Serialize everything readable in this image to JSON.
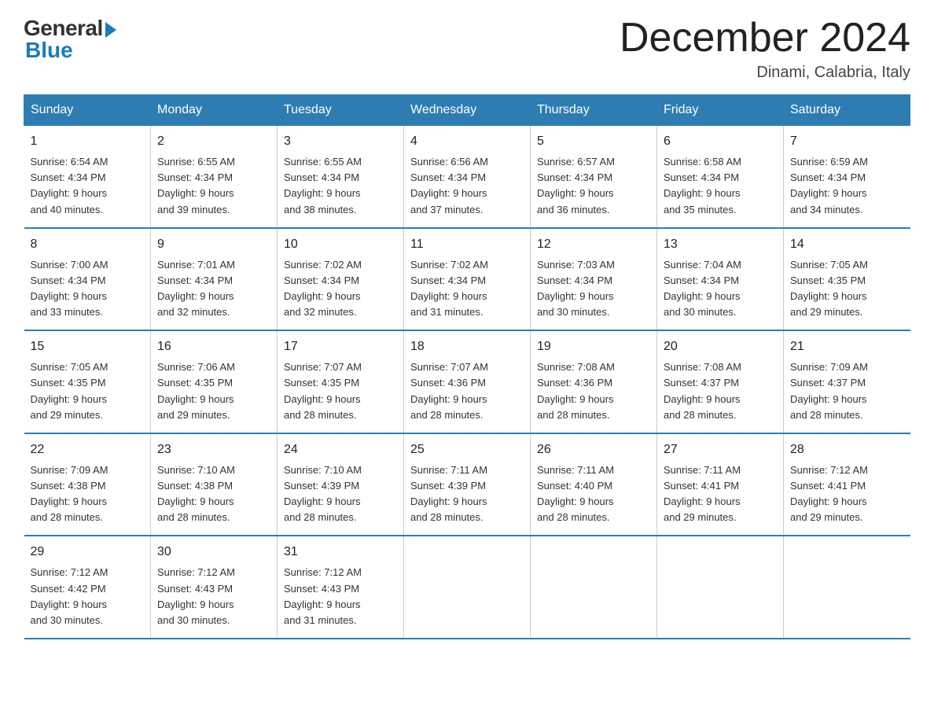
{
  "logo": {
    "general": "General",
    "blue": "Blue"
  },
  "title": "December 2024",
  "location": "Dinami, Calabria, Italy",
  "days_of_week": [
    "Sunday",
    "Monday",
    "Tuesday",
    "Wednesday",
    "Thursday",
    "Friday",
    "Saturday"
  ],
  "weeks": [
    [
      {
        "day": "1",
        "info": "Sunrise: 6:54 AM\nSunset: 4:34 PM\nDaylight: 9 hours\nand 40 minutes."
      },
      {
        "day": "2",
        "info": "Sunrise: 6:55 AM\nSunset: 4:34 PM\nDaylight: 9 hours\nand 39 minutes."
      },
      {
        "day": "3",
        "info": "Sunrise: 6:55 AM\nSunset: 4:34 PM\nDaylight: 9 hours\nand 38 minutes."
      },
      {
        "day": "4",
        "info": "Sunrise: 6:56 AM\nSunset: 4:34 PM\nDaylight: 9 hours\nand 37 minutes."
      },
      {
        "day": "5",
        "info": "Sunrise: 6:57 AM\nSunset: 4:34 PM\nDaylight: 9 hours\nand 36 minutes."
      },
      {
        "day": "6",
        "info": "Sunrise: 6:58 AM\nSunset: 4:34 PM\nDaylight: 9 hours\nand 35 minutes."
      },
      {
        "day": "7",
        "info": "Sunrise: 6:59 AM\nSunset: 4:34 PM\nDaylight: 9 hours\nand 34 minutes."
      }
    ],
    [
      {
        "day": "8",
        "info": "Sunrise: 7:00 AM\nSunset: 4:34 PM\nDaylight: 9 hours\nand 33 minutes."
      },
      {
        "day": "9",
        "info": "Sunrise: 7:01 AM\nSunset: 4:34 PM\nDaylight: 9 hours\nand 32 minutes."
      },
      {
        "day": "10",
        "info": "Sunrise: 7:02 AM\nSunset: 4:34 PM\nDaylight: 9 hours\nand 32 minutes."
      },
      {
        "day": "11",
        "info": "Sunrise: 7:02 AM\nSunset: 4:34 PM\nDaylight: 9 hours\nand 31 minutes."
      },
      {
        "day": "12",
        "info": "Sunrise: 7:03 AM\nSunset: 4:34 PM\nDaylight: 9 hours\nand 30 minutes."
      },
      {
        "day": "13",
        "info": "Sunrise: 7:04 AM\nSunset: 4:34 PM\nDaylight: 9 hours\nand 30 minutes."
      },
      {
        "day": "14",
        "info": "Sunrise: 7:05 AM\nSunset: 4:35 PM\nDaylight: 9 hours\nand 29 minutes."
      }
    ],
    [
      {
        "day": "15",
        "info": "Sunrise: 7:05 AM\nSunset: 4:35 PM\nDaylight: 9 hours\nand 29 minutes."
      },
      {
        "day": "16",
        "info": "Sunrise: 7:06 AM\nSunset: 4:35 PM\nDaylight: 9 hours\nand 29 minutes."
      },
      {
        "day": "17",
        "info": "Sunrise: 7:07 AM\nSunset: 4:35 PM\nDaylight: 9 hours\nand 28 minutes."
      },
      {
        "day": "18",
        "info": "Sunrise: 7:07 AM\nSunset: 4:36 PM\nDaylight: 9 hours\nand 28 minutes."
      },
      {
        "day": "19",
        "info": "Sunrise: 7:08 AM\nSunset: 4:36 PM\nDaylight: 9 hours\nand 28 minutes."
      },
      {
        "day": "20",
        "info": "Sunrise: 7:08 AM\nSunset: 4:37 PM\nDaylight: 9 hours\nand 28 minutes."
      },
      {
        "day": "21",
        "info": "Sunrise: 7:09 AM\nSunset: 4:37 PM\nDaylight: 9 hours\nand 28 minutes."
      }
    ],
    [
      {
        "day": "22",
        "info": "Sunrise: 7:09 AM\nSunset: 4:38 PM\nDaylight: 9 hours\nand 28 minutes."
      },
      {
        "day": "23",
        "info": "Sunrise: 7:10 AM\nSunset: 4:38 PM\nDaylight: 9 hours\nand 28 minutes."
      },
      {
        "day": "24",
        "info": "Sunrise: 7:10 AM\nSunset: 4:39 PM\nDaylight: 9 hours\nand 28 minutes."
      },
      {
        "day": "25",
        "info": "Sunrise: 7:11 AM\nSunset: 4:39 PM\nDaylight: 9 hours\nand 28 minutes."
      },
      {
        "day": "26",
        "info": "Sunrise: 7:11 AM\nSunset: 4:40 PM\nDaylight: 9 hours\nand 28 minutes."
      },
      {
        "day": "27",
        "info": "Sunrise: 7:11 AM\nSunset: 4:41 PM\nDaylight: 9 hours\nand 29 minutes."
      },
      {
        "day": "28",
        "info": "Sunrise: 7:12 AM\nSunset: 4:41 PM\nDaylight: 9 hours\nand 29 minutes."
      }
    ],
    [
      {
        "day": "29",
        "info": "Sunrise: 7:12 AM\nSunset: 4:42 PM\nDaylight: 9 hours\nand 30 minutes."
      },
      {
        "day": "30",
        "info": "Sunrise: 7:12 AM\nSunset: 4:43 PM\nDaylight: 9 hours\nand 30 minutes."
      },
      {
        "day": "31",
        "info": "Sunrise: 7:12 AM\nSunset: 4:43 PM\nDaylight: 9 hours\nand 31 minutes."
      },
      {
        "day": "",
        "info": ""
      },
      {
        "day": "",
        "info": ""
      },
      {
        "day": "",
        "info": ""
      },
      {
        "day": "",
        "info": ""
      }
    ]
  ]
}
